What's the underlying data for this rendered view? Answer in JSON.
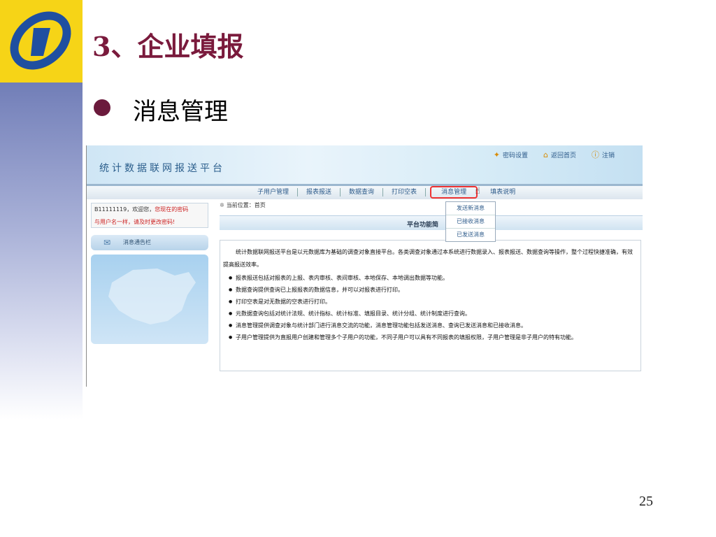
{
  "slide": {
    "title": "3、企业填报",
    "bullet": "消息管理",
    "page_number": "25"
  },
  "app": {
    "banner_title": "统计数据联网报送平台",
    "top_links": [
      {
        "label": "密码设置",
        "icon": "key-icon"
      },
      {
        "label": "返回首页",
        "icon": "home-icon"
      },
      {
        "label": "注销",
        "icon": "info-icon"
      }
    ],
    "nav": [
      "子用户管理",
      "报表报送",
      "数据查询",
      "打印空表",
      "消息管理",
      "填表说明"
    ],
    "nav_highlighted": "消息管理",
    "dropdown": [
      "发送新消息",
      "已接收消息",
      "已发送消息"
    ],
    "welcome": {
      "line1_prefix": "B11111119，欢迎您，",
      "line1_red": "您现在的密码",
      "line2": "与用户名一样，请及时更改密码!"
    },
    "notice_label": "消息通告栏",
    "location": "当前位置：首页",
    "func_title": "平台功能简",
    "intro": "统计数据联网报送平台是以元数据库为基础的调查对象直接平台。各类调查对象通过本系统进行数据录入、报表报送、数据查询等操作，整个过程快捷准确，有效提高报送效率。",
    "bullets": [
      "报表报送包括对报表的上报、表内审核、表间审核、本地保存、本地调出数据等功能。",
      "数据查询提供查询已上报报表的数据信息，并可以对报表进行打印。",
      "打印空表是对无数据的空表进行打印。",
      "元数据查询包括对统计法规、统计指标、统计标准、填报目录、统计分组、统计制度进行查询。",
      "消息管理提供调查对象与统计部门进行消息交流的功能，消息管理功能包括发送消息、查询已发送消息和已接收消息。",
      "子用户管理提供为直报用户创建和管理多个子用户的功能，不同子用户可以具有不同报表的填报权限，子用户管理是非子用户的特有功能。"
    ]
  },
  "colors": {
    "title": "#7a1a3c",
    "logo_bg": "#f6d417",
    "highlight": "#e33333"
  }
}
